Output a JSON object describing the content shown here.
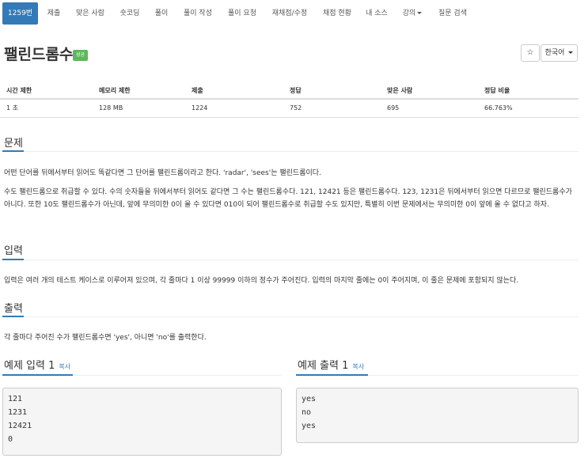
{
  "nav": {
    "items": [
      {
        "label": "1259번",
        "active": true
      },
      {
        "label": "제출"
      },
      {
        "label": "맞은 사람"
      },
      {
        "label": "숏코딩"
      },
      {
        "label": "풀이"
      },
      {
        "label": "풀이 작성"
      },
      {
        "label": "풀이 요청"
      },
      {
        "label": "재채점/수정"
      },
      {
        "label": "채점 현황"
      },
      {
        "label": "내 소스"
      },
      {
        "label": "강의",
        "dropdown": true
      },
      {
        "label": "질문 검색"
      }
    ]
  },
  "problem": {
    "title": "팰린드롬수",
    "status_badge": "성공",
    "star_glyph": "☆",
    "language": "한국어"
  },
  "info_table": {
    "headers": [
      "시간 제한",
      "메모리 제한",
      "제출",
      "정답",
      "맞은 사람",
      "정답 비율"
    ],
    "values": [
      "1 초",
      "128 MB",
      "1224",
      "752",
      "695",
      "66.763%"
    ]
  },
  "sections": {
    "problem_heading": "문제",
    "problem_p1": "어떤 단어를 뒤에서부터 읽어도 똑같다면 그 단어를 팰린드롬이라고 한다. 'radar', 'sees'는 팰린드롬이다.",
    "problem_p2": "수도 팰린드롬으로 취급할 수 있다. 수의 숫자들을 뒤에서부터 읽어도 같다면 그 수는 팰린드롬수다. 121, 12421 등은 팰린드롬수다. 123, 1231은 뒤에서부터 읽으면 다르므로 팰린드롬수가 아니다. 또한 10도 팰린드롬수가 아닌데, 앞에 무의미한 0이 올 수 있다면 010이 되어 팰린드롬수로 취급할 수도 있지만, 특별히 이번 문제에서는 무의미한 0이 앞에 올 수 없다고 하자.",
    "input_heading": "입력",
    "input_p": "입력은 여러 개의 테스트 케이스로 이루어져 있으며, 각 줄마다 1 이상 99999 이하의 정수가 주어진다. 입력의 마지막 줄에는 0이 주어지며, 이 줄은 문제에 포함되지 않는다.",
    "output_heading": "출력",
    "output_p": "각 줄마다 주어진 수가 팰린드롬수면 'yes', 아니면 'no'를 출력한다."
  },
  "samples": {
    "input_heading": "예제 입력 1",
    "output_heading": "예제 출력 1",
    "copy_label": "복사",
    "input_lines": [
      "121",
      "1231",
      "12421",
      "0"
    ],
    "output_lines": [
      "yes",
      "no",
      "yes"
    ]
  },
  "colors": {
    "primary": "#337ab7",
    "success": "#5cb85c"
  }
}
